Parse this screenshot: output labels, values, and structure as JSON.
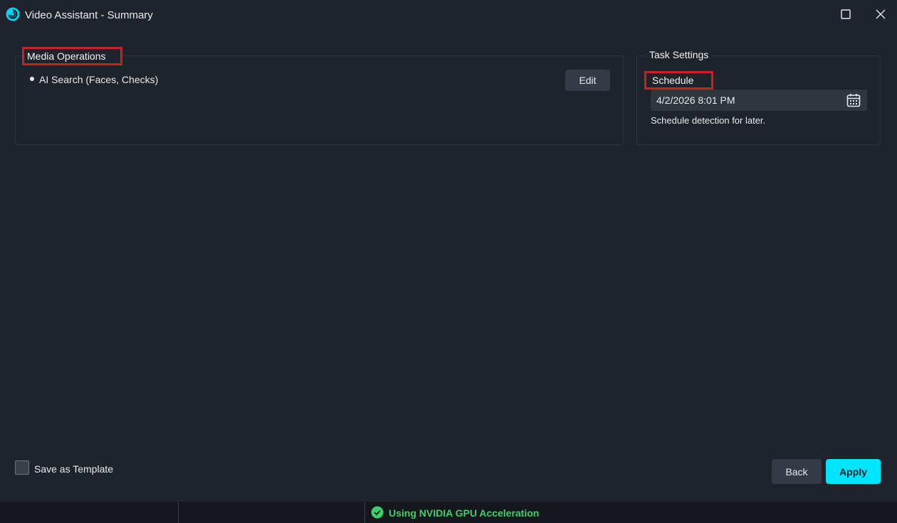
{
  "window": {
    "title": "Video Assistant - Summary",
    "accent_color": "#00e5ff"
  },
  "media_operations": {
    "legend": "Media Operations",
    "items": [
      {
        "label": "AI Search (Faces, Checks)"
      }
    ],
    "edit_label": "Edit"
  },
  "task_settings": {
    "legend": "Task Settings",
    "schedule_label": "Schedule",
    "schedule_value": "4/2/2026 8:01 PM",
    "schedule_hint": "Schedule detection for later."
  },
  "footer": {
    "save_template_label": "Save as Template",
    "save_template_checked": false,
    "back_label": "Back",
    "apply_label": "Apply"
  },
  "status": {
    "gpu_text": "Using NVIDIA GPU Acceleration",
    "gpu_color": "#3ecf6a"
  },
  "icons": {
    "app": "app-logo-icon",
    "maximize": "maximize-icon",
    "close": "close-icon",
    "calendar": "calendar-icon",
    "status": "check-circle-icon"
  }
}
